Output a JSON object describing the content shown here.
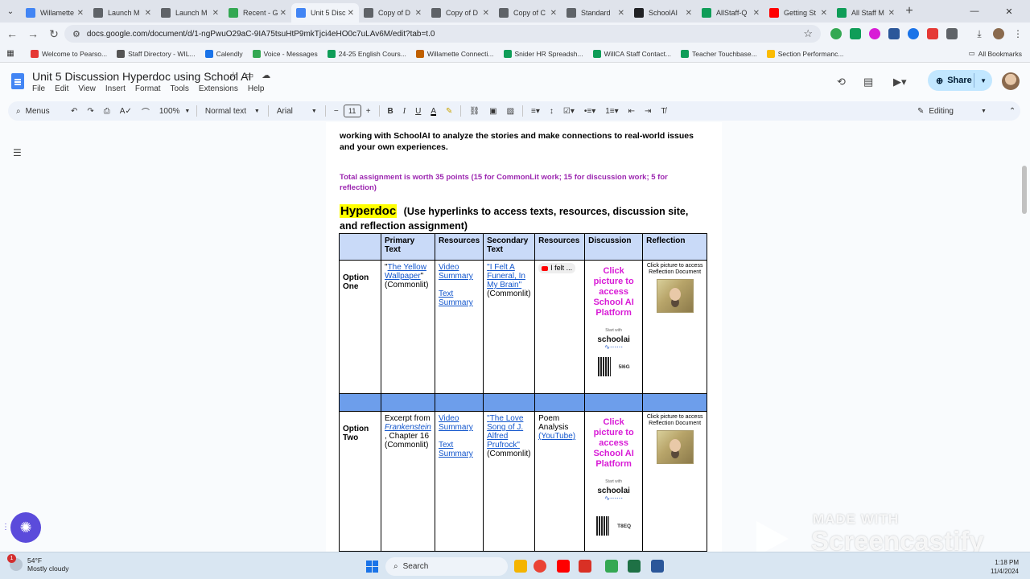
{
  "browser": {
    "tabs": [
      {
        "title": "Willamette",
        "color": "#4285f4",
        "active": false
      },
      {
        "title": "Launch M",
        "color": "#5f6368",
        "active": false
      },
      {
        "title": "Launch M",
        "color": "#5f6368",
        "active": false
      },
      {
        "title": "Recent - G",
        "color": "#34a853",
        "active": false
      },
      {
        "title": "Unit 5 Disc",
        "color": "#4285f4",
        "active": true
      },
      {
        "title": "Copy of D",
        "color": "#5f6368",
        "active": false
      },
      {
        "title": "Copy of D",
        "color": "#5f6368",
        "active": false
      },
      {
        "title": "Copy of C",
        "color": "#5f6368",
        "active": false
      },
      {
        "title": "Standard",
        "color": "#5f6368",
        "active": false
      },
      {
        "title": "SchoolAI",
        "color": "#202124",
        "active": false
      },
      {
        "title": "AllStaff-Q",
        "color": "#0f9d58",
        "active": false
      },
      {
        "title": "Getting St",
        "color": "#ff0000",
        "active": false
      },
      {
        "title": "All Staff M",
        "color": "#0f9d58",
        "active": false
      }
    ],
    "url": "docs.google.com/document/d/1-ngPwuO29aC-9IA75tsuHtP9mkTjci4eHO0c7uLAv6M/edit?tab=t.0",
    "bookmarks": [
      {
        "label": "Welcome to Pearso...",
        "color": "#e53935"
      },
      {
        "label": "Staff Directory - WIL...",
        "color": "#555555"
      },
      {
        "label": "Calendly",
        "color": "#1a73e8"
      },
      {
        "label": "Voice - Messages",
        "color": "#34a853"
      },
      {
        "label": "24-25 English Cours...",
        "color": "#0f9d58"
      },
      {
        "label": "Willamette Connecti...",
        "color": "#c06000"
      },
      {
        "label": "Snider HR Spreadsh...",
        "color": "#0f9d58"
      },
      {
        "label": "WillCA Staff Contact...",
        "color": "#0f9d58"
      },
      {
        "label": "Teacher Touchbase...",
        "color": "#0f9d58"
      },
      {
        "label": "Section Performanc...",
        "color": "#fbbc04"
      }
    ],
    "all_bookmarks": "All Bookmarks"
  },
  "docs": {
    "title": "Unit 5 Discussion Hyperdoc using School AI",
    "menu": [
      "File",
      "Edit",
      "View",
      "Insert",
      "Format",
      "Tools",
      "Extensions",
      "Help"
    ],
    "share_label": "Share",
    "toolbar": {
      "menus_label": "Menus",
      "zoom": "100%",
      "style": "Normal text",
      "font": "Arial",
      "font_size": "11",
      "mode": "Editing"
    }
  },
  "document": {
    "intro": "working with SchoolAI to analyze the stories and make connections to real-world issues and your own experiences.",
    "points": "Total assignment is worth 35 points (15 for CommonLit work; 15 for discussion work; 5 for reflection)",
    "heading_highlight": "Hyperdoc",
    "heading_rest": "(Use hyperlinks to access texts, resources, discussion site, and reflection assignment)",
    "table": {
      "headers": [
        "",
        "Primary Text",
        "Resources",
        "Secondary Text",
        "Resources",
        "Discussion",
        "Reflection"
      ],
      "option_one": {
        "label": "Option One",
        "primary_link": "The Yellow Wallpaper",
        "primary_source": "(Commonlit)",
        "res_video": "Video Summary",
        "res_text": "Text Summary",
        "secondary_link": "I Felt A Funeral, In My Brain",
        "secondary_source": "(Commonlit)",
        "yt_chip": "I felt ...",
        "discussion_cta": "Click picture to access School AI Platform",
        "schoolai_small": "Start with",
        "schoolai_logo": "schoolai",
        "qr_code": "5I6G",
        "reflection_cta": "Click picture to access Reflection Document"
      },
      "option_two": {
        "label": "Option Two",
        "primary_prefix": "Excerpt from",
        "primary_italic": "Frankenstein",
        "primary_suffix": ", Chapter 16",
        "primary_source": "(Commonlit)",
        "res_video": "Video Summary",
        "res_text": "Text Summary",
        "secondary_link": "The Love Song of J. Alfred Prufrock",
        "secondary_source": "(Commonlit)",
        "poem_label": "Poem Analysis",
        "poem_link": "(YouTube)",
        "discussion_cta": "Click picture to access School AI Platform",
        "schoolai_small": "Start with",
        "schoolai_logo": "schoolai",
        "qr_code": "T8EQ",
        "reflection_cta": "Click picture to access Reflection Document"
      }
    }
  },
  "watermark": {
    "made_with": "MADE WITH",
    "brand": "Screencastify"
  },
  "taskbar": {
    "weather_badge": "1",
    "temperature": "54°F",
    "condition": "Mostly cloudy",
    "search_label": "Search",
    "time": "1:18 PM",
    "date": "11/4/2024"
  }
}
